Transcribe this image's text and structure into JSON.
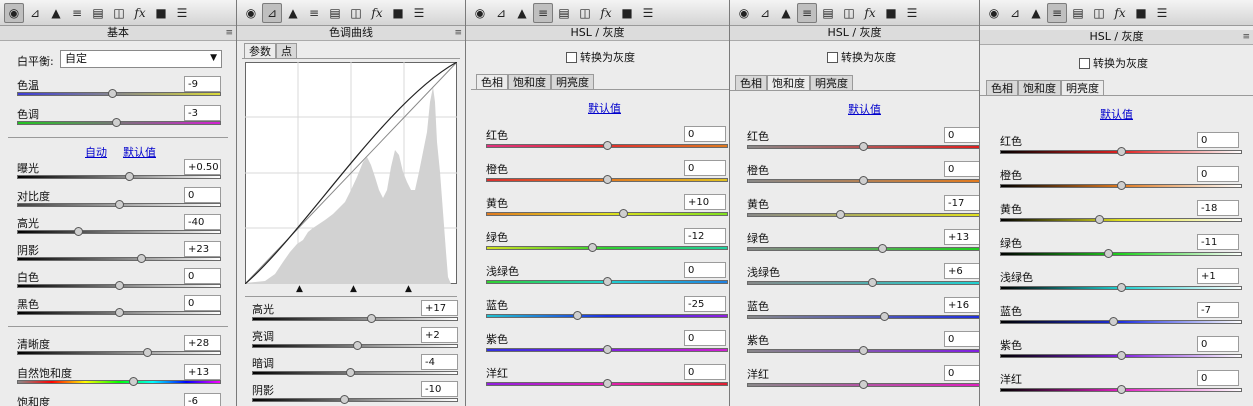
{
  "panel1": {
    "title": "基本",
    "wb_label": "白平衡:",
    "wb_value": "自定",
    "auto": "自动",
    "default": "默认值",
    "sliders": [
      {
        "label": "色温",
        "value": "-9",
        "pos": 0.47,
        "grad": "linear-gradient(90deg,#3d3dd6,#d9d93a)"
      },
      {
        "label": "色调",
        "value": "-3",
        "pos": 0.49,
        "grad": "linear-gradient(90deg,#21c521,#d321d3)"
      },
      {
        "label": "曝光",
        "value": "+0.50",
        "pos": 0.55,
        "grad": "linear-gradient(90deg,#000,#fff)"
      },
      {
        "label": "对比度",
        "value": "0",
        "pos": 0.5,
        "grad": "linear-gradient(90deg,#444,#fff)"
      },
      {
        "label": "高光",
        "value": "-40",
        "pos": 0.3,
        "grad": "linear-gradient(90deg,#000,#fff)"
      },
      {
        "label": "阴影",
        "value": "+23",
        "pos": 0.61,
        "grad": "linear-gradient(90deg,#000,#fff)"
      },
      {
        "label": "白色",
        "value": "0",
        "pos": 0.5,
        "grad": "linear-gradient(90deg,#000,#fff)"
      },
      {
        "label": "黑色",
        "value": "0",
        "pos": 0.5,
        "grad": "linear-gradient(90deg,#000,#fff)"
      },
      {
        "label": "清晰度",
        "value": "+28",
        "pos": 0.64,
        "grad": "linear-gradient(90deg,#000,#fff)"
      },
      {
        "label": "自然饱和度",
        "value": "+13",
        "pos": 0.57,
        "grad": "linear-gradient(90deg,#888,#f00,#ff0,#0f0,#0ff,#00f,#f0f)"
      },
      {
        "label": "饱和度",
        "value": "-6",
        "pos": 0.47,
        "grad": "linear-gradient(90deg,#888,#f00,#ff0,#0f0,#0ff,#00f,#f0f)"
      }
    ]
  },
  "panel2": {
    "title": "色调曲线",
    "tab_param": "参数",
    "tab_point": "点",
    "sliders": [
      {
        "label": "高光",
        "value": "+17",
        "pos": 0.58
      },
      {
        "label": "亮调",
        "value": "+2",
        "pos": 0.51
      },
      {
        "label": "暗调",
        "value": "-4",
        "pos": 0.48
      },
      {
        "label": "阴影",
        "value": "-10",
        "pos": 0.45
      }
    ]
  },
  "hsl_common": {
    "title": "HSL / 灰度",
    "convert_gray": "转换为灰度",
    "tab_hue": "色相",
    "tab_sat": "饱和度",
    "tab_lum": "明亮度",
    "default": "默认值",
    "labels": [
      "红色",
      "橙色",
      "黄色",
      "绿色",
      "浅绿色",
      "蓝色",
      "紫色",
      "洋红"
    ]
  },
  "hue_values": [
    "0",
    "0",
    "+10",
    "-12",
    "0",
    "-25",
    "0",
    "0"
  ],
  "hue_pos": [
    0.5,
    0.5,
    0.57,
    0.44,
    0.5,
    0.38,
    0.5,
    0.5
  ],
  "sat_values": [
    "0",
    "0",
    "-17",
    "+13",
    "+6",
    "+16",
    "0",
    "0"
  ],
  "sat_pos": [
    0.5,
    0.5,
    0.4,
    0.58,
    0.54,
    0.59,
    0.5,
    0.5
  ],
  "lum_values": [
    "0",
    "0",
    "-18",
    "-11",
    "+1",
    "-7",
    "0",
    "0"
  ],
  "lum_pos": [
    0.5,
    0.5,
    0.41,
    0.45,
    0.5,
    0.47,
    0.5,
    0.5
  ],
  "colors": {
    "panel_bg": "#ececec",
    "link": "#0000cc"
  }
}
